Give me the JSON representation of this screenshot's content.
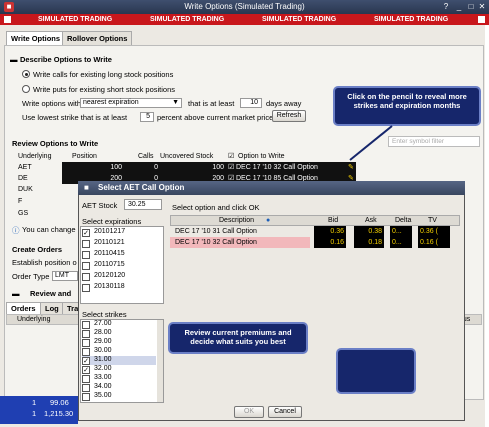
{
  "window": {
    "title": "Write Options (Simulated Trading)",
    "help": "?"
  },
  "sim": {
    "label": "SIMULATED TRADING"
  },
  "tabs": [
    "Write Options",
    "Rollover Options"
  ],
  "describe": {
    "heading": "Describe Options to Write",
    "opt1": "Write calls for existing long stock positions",
    "opt2": "Write puts for existing short stock positions",
    "write_with": "Write options with",
    "expiry_sel": "nearest expiration",
    "at_least": "that is at least",
    "days_val": "10",
    "days_away": "days away",
    "lowest_strike": "Use lowest strike that is at least",
    "pct_val": "5",
    "pct_text": "percent above current market price",
    "refresh": "Refresh"
  },
  "review": {
    "heading": "Review Options to Write",
    "filter_placeholder": "Enter symbol filter",
    "headers": [
      "Underlying",
      "Position",
      "Calls",
      "Uncovered Stock",
      "Option to Write"
    ],
    "rows": [
      {
        "u": "AET",
        "pos": "100",
        "calls": "0",
        "unc": "100",
        "opt": "DEC 17 '10 32 Call Option"
      },
      {
        "u": "DE",
        "pos": "200",
        "calls": "0",
        "unc": "200",
        "opt": "DEC 17 '10 85 Call Option"
      },
      {
        "u": "DUK",
        "pos": "",
        "calls": "",
        "unc": "",
        "opt": ""
      },
      {
        "u": "F",
        "pos": "",
        "calls": "",
        "unc": "",
        "opt": ""
      },
      {
        "u": "GS",
        "pos": "",
        "calls": "",
        "unc": "",
        "opt": ""
      }
    ],
    "info": "You can change"
  },
  "create": {
    "heading": "Create Orders",
    "establish": "Establish position o",
    "order_type": "Order Type",
    "order_val": "LMT"
  },
  "review_and": "Review and",
  "bottom_tabs": [
    "Orders",
    "Log",
    "Tra"
  ],
  "bottom_header": {
    "underlying": "Underlying",
    "status": "atus"
  },
  "bottom_rows": [
    {
      "a": "1",
      "b": "99.06"
    },
    {
      "a": "1",
      "b": "1,215.30"
    }
  ],
  "callouts": {
    "pencil": "Click on the pencil to reveal more strikes and expiration months",
    "premium": "Review current premiums and decide what suits you best",
    "blank": ""
  },
  "dialog": {
    "title": "Select AET Call Option",
    "stock_label": "AET Stock",
    "stock_price": "30.25",
    "instr": "Select option and click OK",
    "exp_label": "Select expirations",
    "expirations": [
      {
        "v": "20101217",
        "c": true
      },
      {
        "v": "20110121",
        "c": false
      },
      {
        "v": "20110415",
        "c": false
      },
      {
        "v": "20110715",
        "c": false
      },
      {
        "v": "20120120",
        "c": false
      },
      {
        "v": "20130118",
        "c": false
      }
    ],
    "strikes_label": "Select strikes",
    "strikes": [
      {
        "v": "27.00",
        "c": false
      },
      {
        "v": "28.00",
        "c": false
      },
      {
        "v": "29.00",
        "c": false
      },
      {
        "v": "30.00",
        "c": false
      },
      {
        "v": "31.00",
        "c": true
      },
      {
        "v": "32.00",
        "c": true
      },
      {
        "v": "33.00",
        "c": false
      },
      {
        "v": "34.00",
        "c": false
      },
      {
        "v": "35.00",
        "c": false
      }
    ],
    "headers": [
      "Description",
      "Bid",
      "Ask",
      "Delta",
      "TV"
    ],
    "rows": [
      {
        "desc": "DEC 17 '10 31 Call Option",
        "bid": "0.36",
        "ask": "0.38",
        "delta": "0...",
        "tv": "0.36 ("
      },
      {
        "desc": "DEC 17 '10 32 Call Option",
        "bid": "0.16",
        "ask": "0.18",
        "delta": "0...",
        "tv": "0.16 ("
      }
    ],
    "ok": "OK",
    "cancel": "Cancel"
  },
  "colors": {
    "accent": "#c8171c",
    "callout": "#16266b",
    "selected": "#f2b8bb"
  }
}
